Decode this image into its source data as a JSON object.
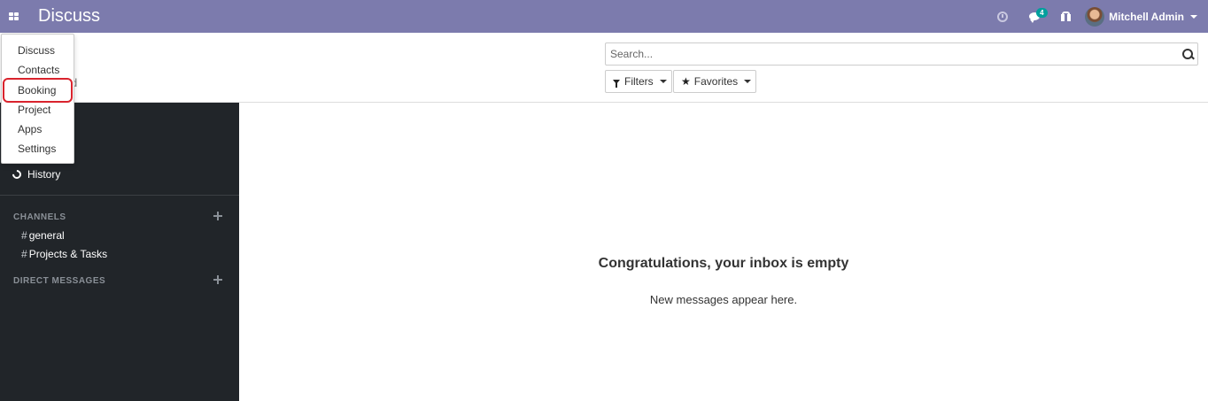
{
  "navbar": {
    "brand": "Discuss",
    "chat_badge": "4",
    "user_name": "Mitchell Admin"
  },
  "apps_menu": {
    "items": [
      "Discuss",
      "Contacts",
      "Booking",
      "Project",
      "Apps",
      "Settings"
    ],
    "highlighted": "Booking"
  },
  "control_panel": {
    "breadcrumb_partial": "d",
    "search_placeholder": "Search...",
    "filters_label": "Filters",
    "favorites_label": "Favorites"
  },
  "sidebar": {
    "history_label": "History",
    "channels_title": "CHANNELS",
    "channels": [
      "general",
      "Projects & Tasks"
    ],
    "direct_messages_title": "DIRECT MESSAGES"
  },
  "main": {
    "empty_title": "Congratulations, your inbox is empty",
    "empty_subtitle": "New messages appear here."
  },
  "colors": {
    "navbar": "#7c7bad",
    "sidebar": "#212529",
    "badge": "#00a09d",
    "highlight": "#d9232d"
  }
}
